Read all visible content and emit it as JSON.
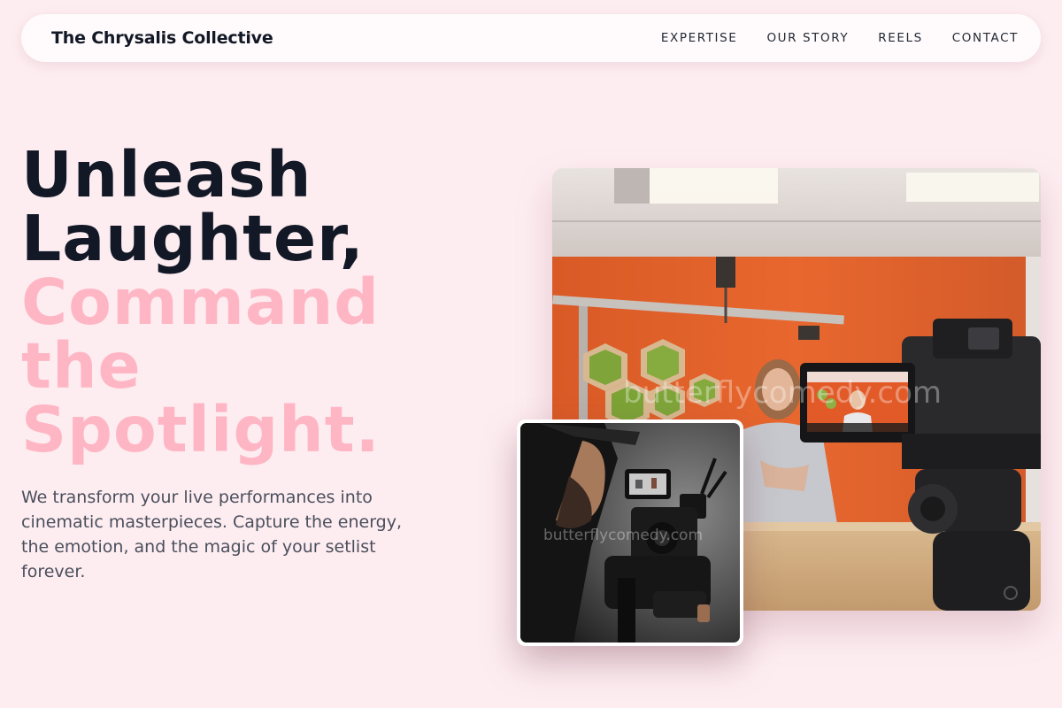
{
  "nav": {
    "brand": "The Chrysalis Collective",
    "links": [
      "EXPERTISE",
      "OUR STORY",
      "REELS",
      "CONTACT"
    ]
  },
  "hero": {
    "title_line1": "Unleash",
    "title_line2": "Laughter,",
    "title_line3": "Command",
    "title_line4": "the",
    "title_line5": "Spotlight.",
    "subtitle": "We transform your live performances into cinematic masterpieces. Capture the energy, the emotion, and the magic of your setlist forever."
  },
  "images": {
    "main_watermark": "butterflycomedy.com",
    "small_watermark": "butterflycomedy.com"
  },
  "colors": {
    "background": "#fdedf1",
    "accent_pink": "#ffb6c4",
    "dark_text": "#121826",
    "studio_wall": "#e0642c"
  }
}
